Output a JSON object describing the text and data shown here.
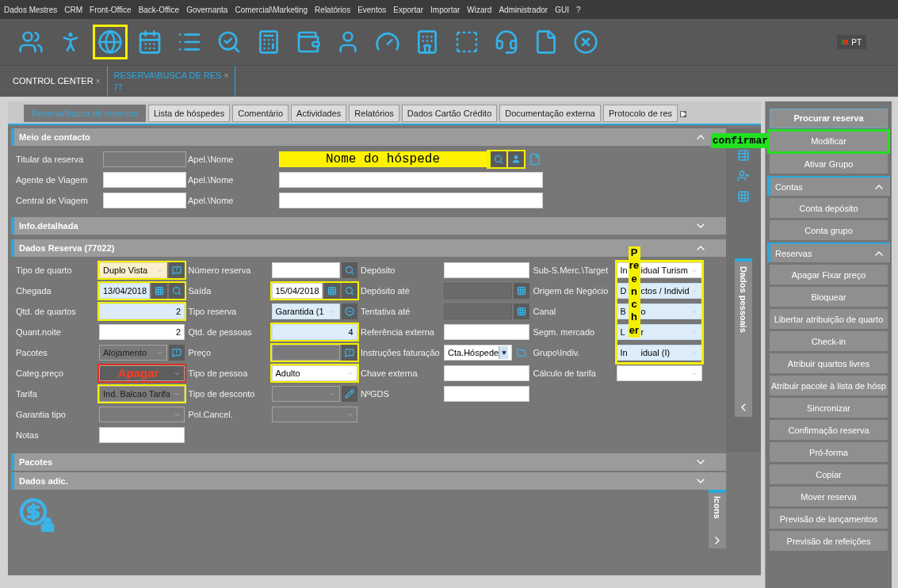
{
  "menu": [
    "Dados Mestres",
    "CRM",
    "Front-Office",
    "Back-Office",
    "Governanta",
    "Comercial\\Marketing",
    "Relatórios",
    "Eventos",
    "Exportar",
    "Importar",
    "Wizard",
    "Administrador",
    "GUI",
    "?"
  ],
  "toolbar": [
    {
      "selected": false
    },
    {
      "selected": false
    },
    {
      "selected": true
    },
    {
      "selected": false
    },
    {
      "selected": false
    },
    {
      "selected": false
    },
    {
      "selected": false
    },
    {
      "selected": false
    },
    {
      "selected": false
    },
    {
      "selected": false
    },
    {
      "selected": false
    },
    {
      "selected": false
    },
    {
      "selected": false
    },
    {
      "selected": false
    },
    {
      "selected": false
    }
  ],
  "language": "PT",
  "doc_tabs": [
    {
      "label": "CONTROL CENTER",
      "close": "×",
      "selected": false
    },
    {
      "label": "RESERVA\\BUSCA DE RES",
      "sub": "77",
      "close": "×",
      "selected": true
    }
  ],
  "tabs": [
    {
      "label": "Reserva\\busca de reservas",
      "selected": true
    },
    {
      "label": "Lista de hóspedes",
      "selected": false
    },
    {
      "label": "Comentário",
      "selected": false
    },
    {
      "label": "Actividades",
      "selected": false
    },
    {
      "label": "Relatórios",
      "selected": false
    },
    {
      "label": "Dados Cartão Crédito",
      "selected": false
    },
    {
      "label": "Documentação externa",
      "selected": false
    },
    {
      "label": "Protocolo de res",
      "selected": false
    }
  ],
  "contact": {
    "title": "Meio de contacto",
    "expanded": true,
    "rows": [
      {
        "label": "Titular da reserva",
        "name_label": "Apel.\\Nome",
        "annotation": "Nome do hóspede"
      },
      {
        "label": "Agente de Viagem",
        "name_label": "Apel.\\Nome"
      },
      {
        "label": "Central de Viagem",
        "name_label": "Apel.\\Nome"
      }
    ]
  },
  "info": {
    "title": "Info.detalhada",
    "expanded": false
  },
  "reservation": {
    "title": "Dados Reserva (77022)",
    "expanded": true,
    "note": "Preencher",
    "columns": [
      [
        {
          "label": "Tipo de quarto",
          "kind": "dropdown",
          "value": "Duplo Vista",
          "highlighted": true
        },
        {
          "label": "Chegada",
          "kind": "text",
          "value": "13/04/2018",
          "highlighted": true
        },
        {
          "label": "Qtd. de quartos",
          "kind": "number",
          "value": "2",
          "highlighted": true
        },
        {
          "label": "Quant.noite",
          "kind": "number",
          "value": "2",
          "highlighted": false
        },
        {
          "label": "Pacotes",
          "kind": "dropdown",
          "value": "Alojamento",
          "highlighted": false
        },
        {
          "label": "Categ.preço",
          "kind": "dropdown",
          "annotation": "Apagar",
          "highlighted": true
        },
        {
          "label": "Tarifa",
          "kind": "dropdown",
          "value": "Ind. Balcao Tarifa",
          "highlighted": true
        },
        {
          "label": "Garantia tipo",
          "kind": "dropdown",
          "highlighted": false
        },
        {
          "label": "Notas",
          "kind": "text",
          "highlighted": false
        }
      ],
      [
        {
          "label": "Número reserva",
          "kind": "text",
          "highlighted": false
        },
        {
          "label": "Saída",
          "kind": "text",
          "value": "15/04/2018",
          "highlighted": true
        },
        {
          "label": "Tipo reserva",
          "kind": "dropdown",
          "value": "Garantida (1",
          "highlighted": false
        },
        {
          "label": "Qtd. de pessoas",
          "kind": "number",
          "value": "4",
          "highlighted": true
        },
        {
          "label": "Preço",
          "kind": "text",
          "highlighted": true
        },
        {
          "label": "Tipo de pessoa",
          "kind": "dropdown",
          "value": "Adulto",
          "highlighted": true
        },
        {
          "label": "Tipo de desconto",
          "kind": "dropdown",
          "highlighted": false
        },
        {
          "label": "Pol.Cancel.",
          "kind": "dropdown",
          "highlighted": false
        }
      ],
      [
        {
          "label": "Depósito",
          "kind": "text",
          "highlighted": false
        },
        {
          "label": "Depósito até",
          "kind": "text",
          "highlighted": false
        },
        {
          "label": "Tentativa até",
          "kind": "text",
          "highlighted": false
        },
        {
          "label": "Referência externa",
          "kind": "text",
          "highlighted": false
        },
        {
          "label": "Instruções faturação",
          "kind": "combo",
          "value": "Cta.Hóspede",
          "highlighted": false
        },
        {
          "label": "Chave externa",
          "kind": "text",
          "highlighted": false
        },
        {
          "label": "NºGDS",
          "kind": "text",
          "highlighted": false
        }
      ],
      [
        {
          "label": "Sub-S.Merc.\\Target",
          "kind": "dropdown",
          "parts": [
            "In",
            "idual Turism"
          ],
          "highlighted": false
        },
        {
          "label": "Origem de Negócio",
          "kind": "dropdown",
          "parts": [
            "D",
            "ctos / Individ"
          ],
          "highlighted": false
        },
        {
          "label": "Canal",
          "kind": "dropdown",
          "parts": [
            "B",
            "o"
          ],
          "highlighted": false
        },
        {
          "label": "Segm. mercado",
          "kind": "dropdown",
          "parts": [
            "L",
            "r"
          ],
          "highlighted": false
        },
        {
          "label": "Grupo\\Indiv.",
          "kind": "dropdown",
          "parts": [
            "In",
            "idual (I)"
          ],
          "highlighted": false
        },
        {
          "label": "Cálculo de tarifa",
          "kind": "dropdown",
          "highlighted": false
        }
      ]
    ]
  },
  "sections": [
    {
      "title": "Pacotes",
      "expanded": false
    },
    {
      "title": "Dados adic.",
      "expanded": false
    }
  ],
  "side_tabs": [
    "Dados pessoais",
    "Icons"
  ],
  "actions": {
    "top": [
      {
        "label": "Procurar reserva",
        "kind": "primary",
        "highlighted": false
      },
      {
        "label": "Modificar",
        "kind": "plain",
        "highlighted": true,
        "annotation": "confirmar"
      },
      {
        "label": "Ativar Grupo",
        "kind": "plain",
        "highlighted": false
      }
    ],
    "groups": [
      {
        "title": "Contas",
        "expanded": true,
        "items": [
          "Conta depósito",
          "Conta grupo"
        ]
      },
      {
        "title": "Reservas",
        "expanded": true,
        "items": [
          "Apagar Fixar preço",
          "Bloquear",
          "Libertar atribuição de quarto",
          "Check-in",
          "Atribuir quartos livres",
          "Atribuir pacote à lista de hósp",
          "Sincronizar",
          "Confirmação reserva",
          "Pró-forma",
          "Copiar",
          "Mover reserva",
          "Previsão de lançamentos",
          "Previsão de refeições"
        ]
      }
    ]
  }
}
